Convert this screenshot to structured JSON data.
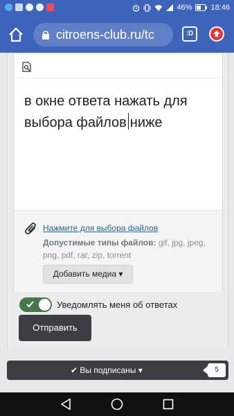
{
  "status_bar": {
    "battery_percent": "46%",
    "time": "18:46",
    "left_icons": [
      "app-icon-blue",
      "app-icon-grid",
      "cloud-icon",
      "chat-icon",
      "app-icon-red"
    ],
    "right_icons": [
      "alarm-icon",
      "vibrate-icon",
      "wifi-icon",
      "signal-icon",
      "battery-icon"
    ]
  },
  "browser": {
    "url": "citroens-club.ru/tc",
    "tabs_label": ":D",
    "accent": "#3d63ba"
  },
  "editor": {
    "content_before_caret": "в окне ответа нажать для выбора файлов",
    "content_after_caret": "ниже"
  },
  "attachments": {
    "link_label": "Нажмите для выбора файлов",
    "allowed_label": "Допустимые типы файлов:",
    "allowed_types": "gif, jpg, jpeg, png, pdf, rar, zip, torrent",
    "media_button": "Добавить медиа ▾"
  },
  "notify": {
    "label": "Уведомлять меня об ответах",
    "enabled": true,
    "toggle_color": "#46784a"
  },
  "submit": {
    "label": "Отправить"
  },
  "subscription": {
    "label": "✔ Вы подписаны ▾",
    "count": "5"
  }
}
